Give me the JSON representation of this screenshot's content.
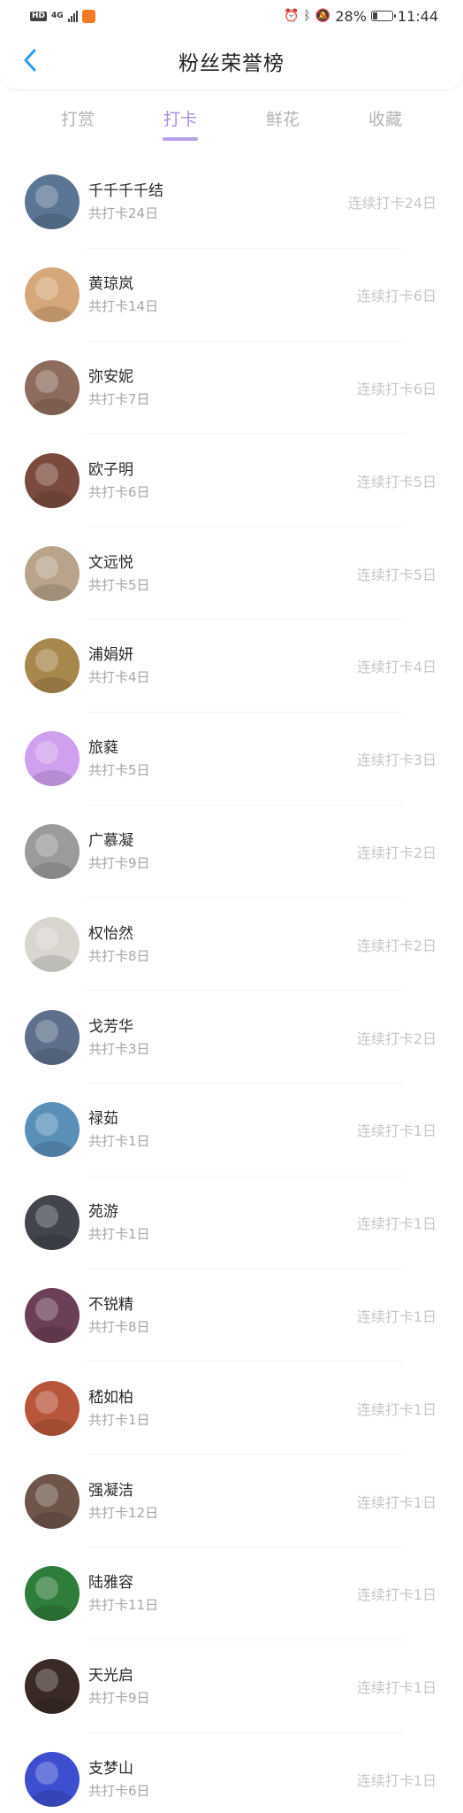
{
  "status_bar": {
    "hd": "HD",
    "network": "4G",
    "battery": "28%",
    "battery_level": 0.28,
    "time": "11:44",
    "icons": [
      "alarm-icon",
      "bluetooth-icon",
      "mute-icon"
    ]
  },
  "header": {
    "title": "粉丝荣誉榜",
    "back_icon": "chevron-left-icon",
    "accent_color": "#2f9de8"
  },
  "tabs": [
    {
      "label": "打赏",
      "active": false
    },
    {
      "label": "打卡",
      "active": true
    },
    {
      "label": "鲜花",
      "active": false
    },
    {
      "label": "收藏",
      "active": false
    }
  ],
  "fans": [
    {
      "name": "千千千千结",
      "total": "共打卡24日",
      "streak": "连续打卡24日",
      "avatar_color": "#5b7694"
    },
    {
      "name": "黄琼岚",
      "total": "共打卡14日",
      "streak": "连续打卡6日",
      "avatar_color": "#d6a77a"
    },
    {
      "name": "弥安妮",
      "total": "共打卡7日",
      "streak": "连续打卡6日",
      "avatar_color": "#8e6c5d"
    },
    {
      "name": "欧子明",
      "total": "共打卡6日",
      "streak": "连续打卡5日",
      "avatar_color": "#7a4a3e"
    },
    {
      "name": "文远悦",
      "total": "共打卡5日",
      "streak": "连续打卡5日",
      "avatar_color": "#b9a38b"
    },
    {
      "name": "浦娟妍",
      "total": "共打卡4日",
      "streak": "连续打卡4日",
      "avatar_color": "#a8874d"
    },
    {
      "name": "旅蕤",
      "total": "共打卡5日",
      "streak": "连续打卡3日",
      "avatar_color": "#cfa0ee"
    },
    {
      "name": "广慕凝",
      "total": "共打卡9日",
      "streak": "连续打卡2日",
      "avatar_color": "#9b9b9b"
    },
    {
      "name": "权怡然",
      "total": "共打卡8日",
      "streak": "连续打卡2日",
      "avatar_color": "#d9d6d0"
    },
    {
      "name": "戈芳华",
      "total": "共打卡3日",
      "streak": "连续打卡2日",
      "avatar_color": "#5d6f8a"
    },
    {
      "name": "禄茹",
      "total": "共打卡1日",
      "streak": "连续打卡1日",
      "avatar_color": "#5a8fb8"
    },
    {
      "name": "苑游",
      "total": "共打卡1日",
      "streak": "连续打卡1日",
      "avatar_color": "#43454d"
    },
    {
      "name": "不锐精",
      "total": "共打卡8日",
      "streak": "连续打卡1日",
      "avatar_color": "#6b3f57"
    },
    {
      "name": "嵇如柏",
      "total": "共打卡1日",
      "streak": "连续打卡1日",
      "avatar_color": "#b8563b"
    },
    {
      "name": "强凝洁",
      "total": "共打卡12日",
      "streak": "连续打卡1日",
      "avatar_color": "#6e5449"
    },
    {
      "name": "陆雅容",
      "total": "共打卡11日",
      "streak": "连续打卡1日",
      "avatar_color": "#2f7d3a"
    },
    {
      "name": "天光启",
      "total": "共打卡9日",
      "streak": "连续打卡1日",
      "avatar_color": "#3a2a26"
    },
    {
      "name": "支梦山",
      "total": "共打卡6日",
      "streak": "连续打卡1日",
      "avatar_color": "#3d4fd0"
    }
  ]
}
